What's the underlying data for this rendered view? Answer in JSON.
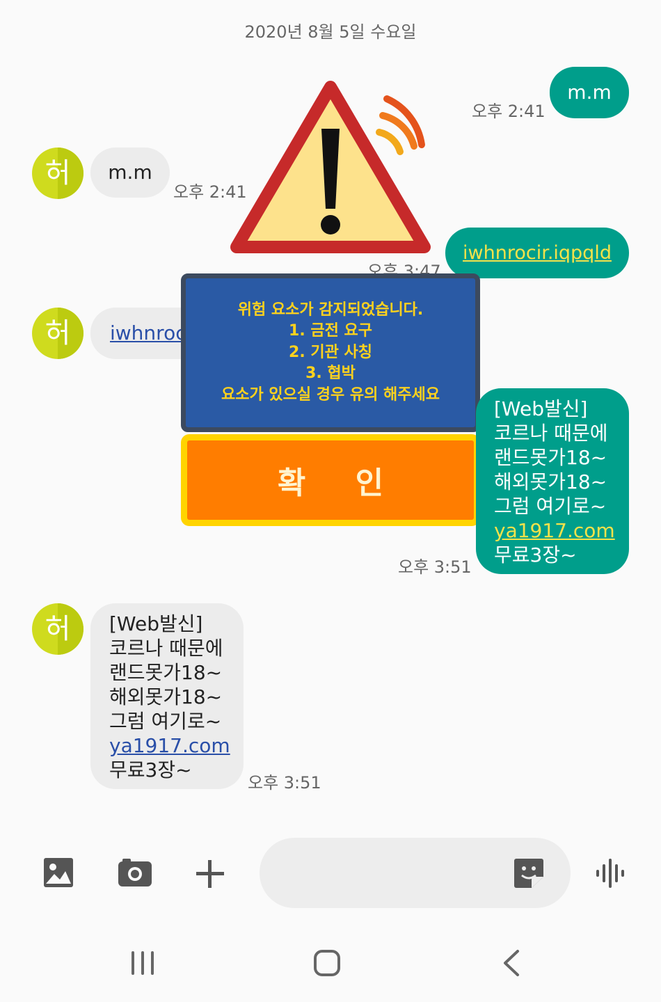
{
  "header": {
    "date": "2020년 8월 5일 수요일"
  },
  "messages": {
    "m1": {
      "text": "m.m",
      "time": "오후 2:41"
    },
    "m2": {
      "avatar": "허",
      "text": "m.m",
      "time": "오후 2:41"
    },
    "m3": {
      "text": "iwhnrocir.iqpqld",
      "time": "오후 3:47"
    },
    "m4": {
      "avatar": "허",
      "text": "iwhnroc"
    },
    "m5": {
      "lines": "[Web발신]\n코르나 때문에\n랜드못가18~\n해외못가18~\n그럼 여기로~",
      "link": "ya1917.com",
      "tail": "무료3장~",
      "time": "오후 3:51"
    },
    "m6": {
      "avatar": "허",
      "lines": "[Web발신]\n코르나 때문에\n랜드못가18~\n해외못가18~\n그럼 여기로~",
      "link": "ya1917.com",
      "tail": "무료3장~",
      "time": "오후 3:51"
    }
  },
  "warning": {
    "lines": [
      "위험 요소가 감지되었습니다.",
      "1. 금전 요구",
      "2. 기관 사칭",
      "3. 협박",
      "요소가 있으실 경우 유의 해주세요"
    ],
    "confirm_label": "확 인",
    "icon": "warning-triangle-icon"
  },
  "toolbar": {
    "icons": [
      "image-icon",
      "camera-icon",
      "plus-icon",
      "sticker-icon",
      "voice-icon"
    ]
  },
  "navbar": {
    "icons": [
      "recents-icon",
      "home-icon",
      "back-icon"
    ]
  },
  "colors": {
    "outgoing": "#009e8b",
    "incoming": "#ececec",
    "avatar": "#cfdb1e",
    "panel": "#2a5aa5",
    "confirm": "#ff7d00"
  }
}
